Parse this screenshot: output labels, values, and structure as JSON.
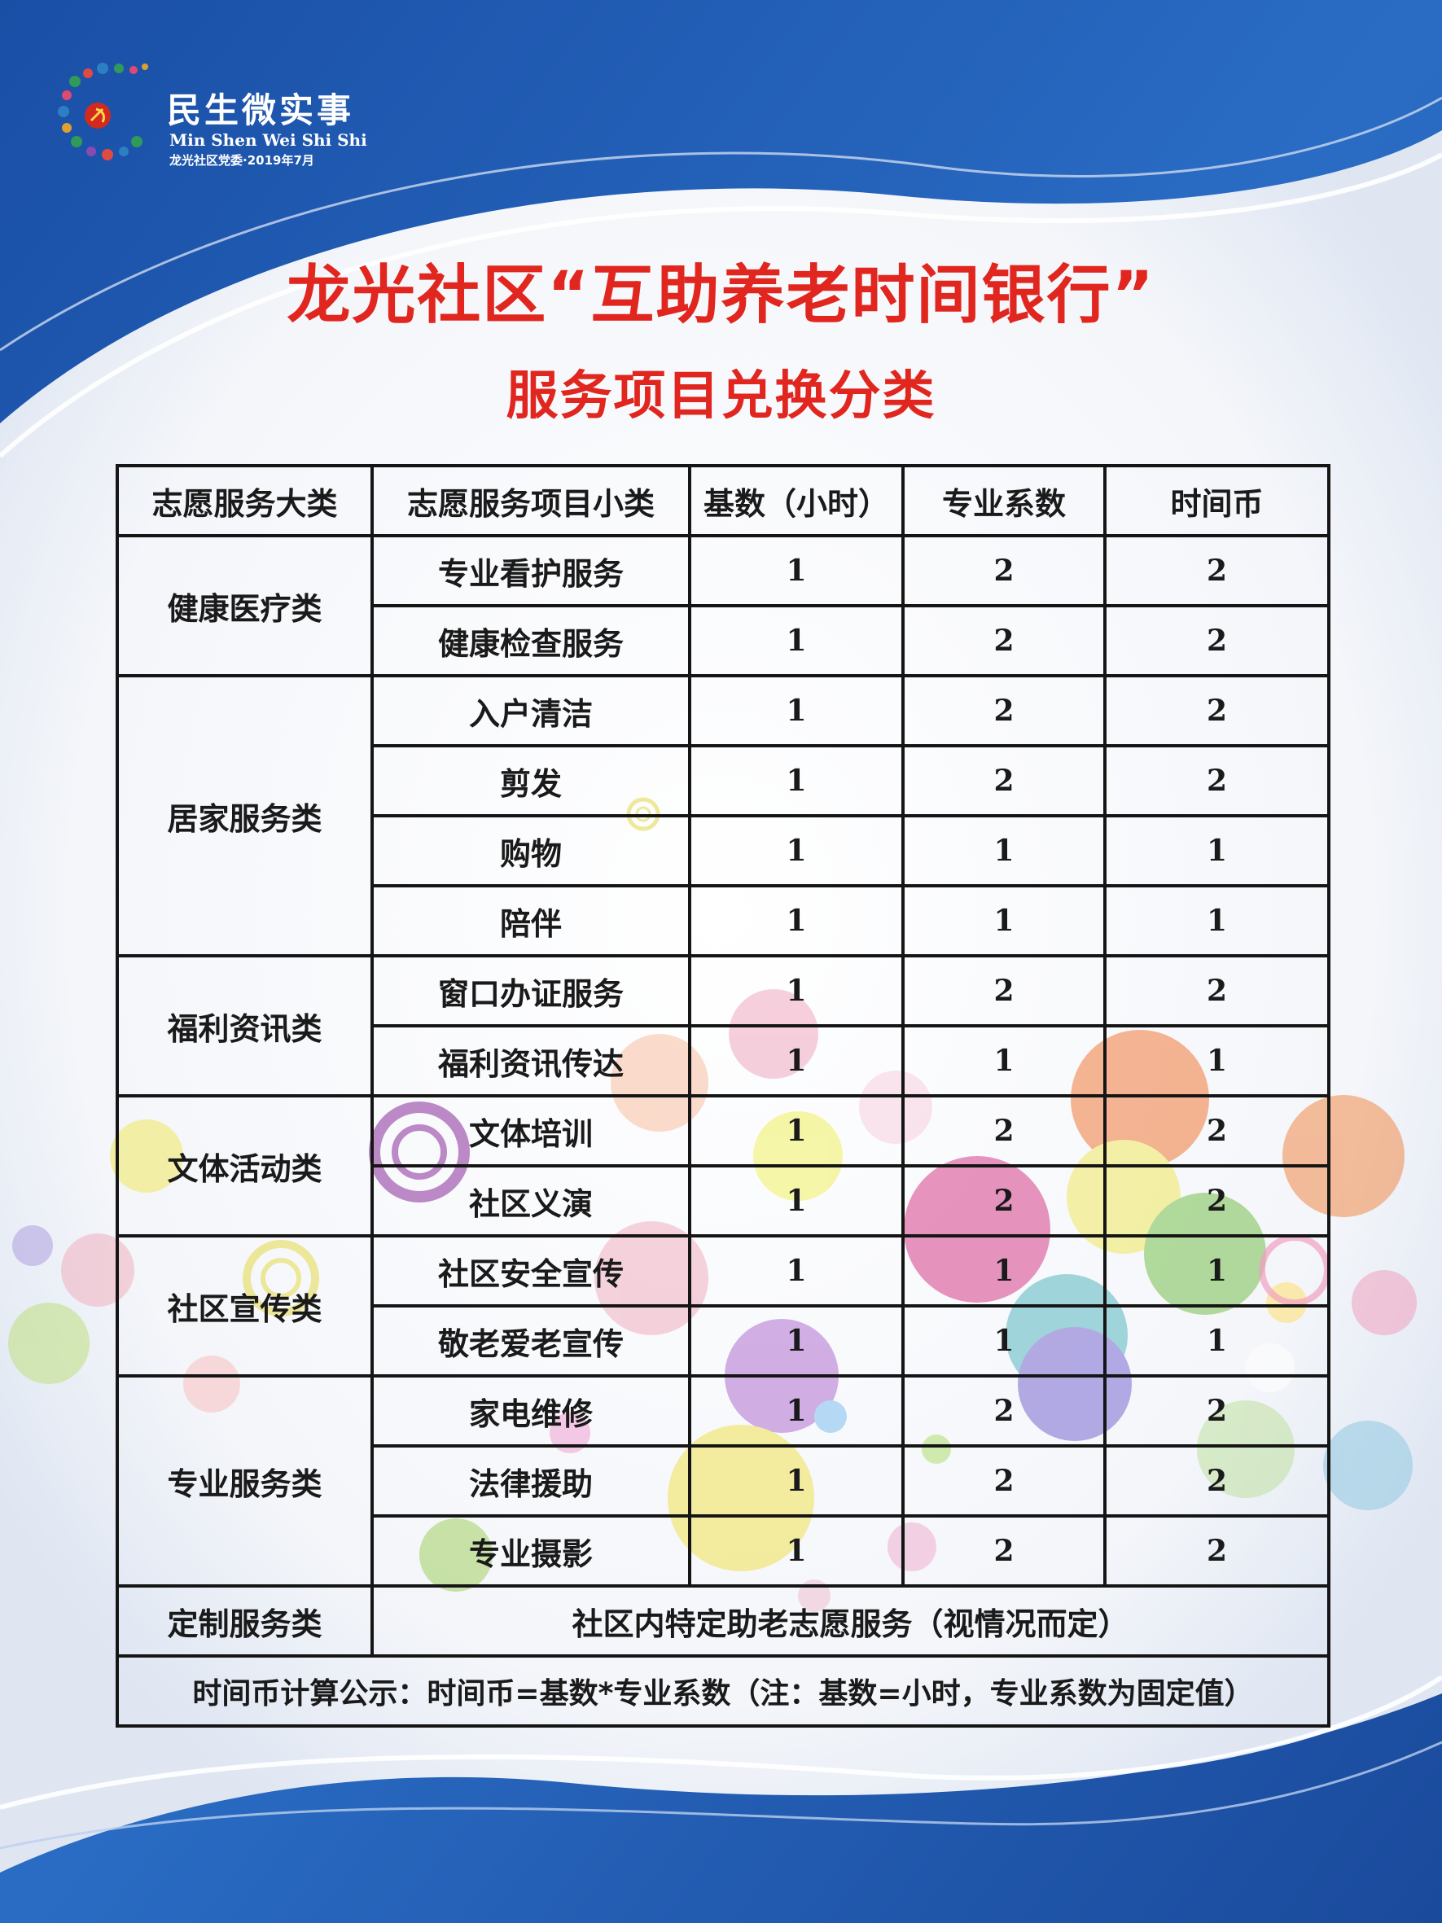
{
  "logo": {
    "title": "民生微实事",
    "pinyin": "Min Shen Wei Shi Shi",
    "subtitle": "龙光社区党委·2019年7月"
  },
  "title": "龙光社区“互助养老时间银行”",
  "subtitle": "服务项目兑换分类",
  "table": {
    "headers": [
      "志愿服务大类",
      "志愿服务项目小类",
      "基数（小时）",
      "专业系数",
      "时间币"
    ],
    "groups": [
      {
        "category": "健康医疗类",
        "items": [
          {
            "name": "专业看护服务",
            "base": "1",
            "coef": "2",
            "coin": "2"
          },
          {
            "name": "健康检查服务",
            "base": "1",
            "coef": "2",
            "coin": "2"
          }
        ]
      },
      {
        "category": "居家服务类",
        "items": [
          {
            "name": "入户清洁",
            "base": "1",
            "coef": "2",
            "coin": "2"
          },
          {
            "name": "剪发",
            "base": "1",
            "coef": "2",
            "coin": "2"
          },
          {
            "name": "购物",
            "base": "1",
            "coef": "1",
            "coin": "1"
          },
          {
            "name": "陪伴",
            "base": "1",
            "coef": "1",
            "coin": "1"
          }
        ]
      },
      {
        "category": "福利资讯类",
        "items": [
          {
            "name": "窗口办证服务",
            "base": "1",
            "coef": "2",
            "coin": "2"
          },
          {
            "name": "福利资讯传达",
            "base": "1",
            "coef": "1",
            "coin": "1"
          }
        ]
      },
      {
        "category": "文体活动类",
        "items": [
          {
            "name": "文体培训",
            "base": "1",
            "coef": "2",
            "coin": "2"
          },
          {
            "name": "社区义演",
            "base": "1",
            "coef": "2",
            "coin": "2"
          }
        ]
      },
      {
        "category": "社区宣传类",
        "items": [
          {
            "name": "社区安全宣传",
            "base": "1",
            "coef": "1",
            "coin": "1"
          },
          {
            "name": "敬老爱老宣传",
            "base": "1",
            "coef": "1",
            "coin": "1"
          }
        ]
      },
      {
        "category": "专业服务类",
        "items": [
          {
            "name": "家电维修",
            "base": "1",
            "coef": "2",
            "coin": "2"
          },
          {
            "name": "法律援助",
            "base": "1",
            "coef": "2",
            "coin": "2"
          },
          {
            "name": "专业摄影",
            "base": "1",
            "coef": "2",
            "coin": "2"
          }
        ]
      }
    ],
    "custom": {
      "category": "定制服务类",
      "description": "社区内特定助老志愿服务（视情况而定）"
    },
    "formula": "时间币计算公示：时间币=基数*专业系数（注：基数=小时，专业系数为固定值）"
  },
  "colors": {
    "background_blue": "#1f5db3",
    "title_red": "#e0261f",
    "border": "#151515"
  }
}
